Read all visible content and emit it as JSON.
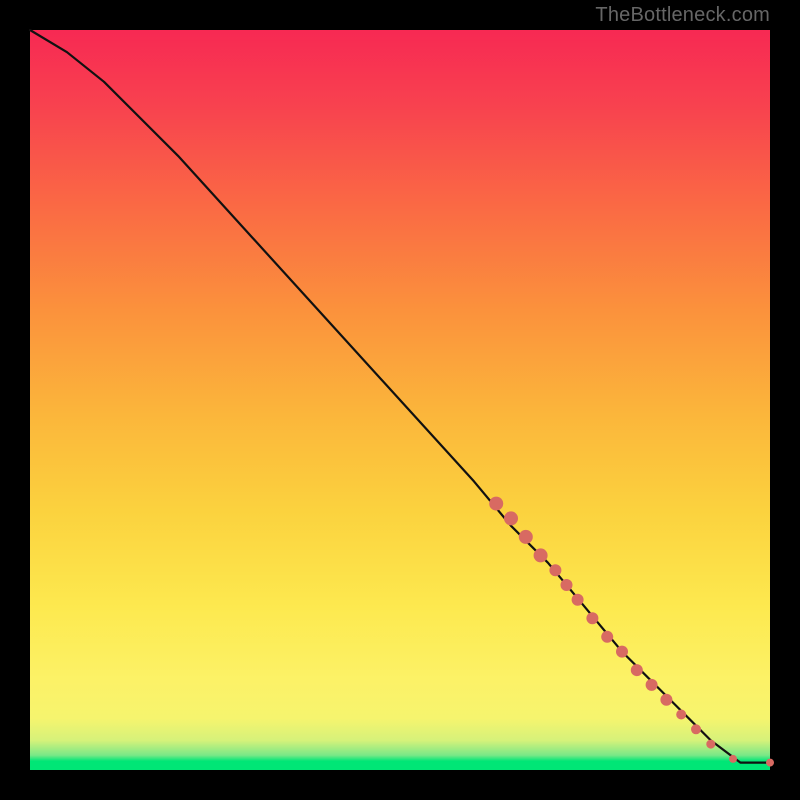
{
  "watermark": "TheBottleneck.com",
  "chart_data": {
    "type": "line",
    "title": "",
    "xlabel": "",
    "ylabel": "",
    "xlim": [
      0,
      100
    ],
    "ylim": [
      0,
      100
    ],
    "grid": false,
    "series": [
      {
        "name": "curve",
        "x": [
          0,
          5,
          10,
          20,
          30,
          40,
          50,
          60,
          65,
          70,
          75,
          80,
          83,
          86,
          89,
          92,
          94,
          96,
          98,
          100
        ],
        "y": [
          100,
          97,
          93,
          83,
          72,
          61,
          50,
          39,
          33,
          28,
          22,
          16,
          13,
          10,
          7,
          4,
          2.5,
          1,
          1,
          1
        ]
      }
    ],
    "scatter": {
      "name": "highlighted-points",
      "color": "#d86a62",
      "points": [
        {
          "x": 63,
          "y": 36,
          "r": 7
        },
        {
          "x": 65,
          "y": 34,
          "r": 7
        },
        {
          "x": 67,
          "y": 31.5,
          "r": 7
        },
        {
          "x": 69,
          "y": 29,
          "r": 7
        },
        {
          "x": 71,
          "y": 27,
          "r": 6
        },
        {
          "x": 72.5,
          "y": 25,
          "r": 6
        },
        {
          "x": 74,
          "y": 23,
          "r": 6
        },
        {
          "x": 76,
          "y": 20.5,
          "r": 6
        },
        {
          "x": 78,
          "y": 18,
          "r": 6
        },
        {
          "x": 80,
          "y": 16,
          "r": 6
        },
        {
          "x": 82,
          "y": 13.5,
          "r": 6
        },
        {
          "x": 84,
          "y": 11.5,
          "r": 6
        },
        {
          "x": 86,
          "y": 9.5,
          "r": 6
        },
        {
          "x": 88,
          "y": 7.5,
          "r": 5
        },
        {
          "x": 90,
          "y": 5.5,
          "r": 5
        },
        {
          "x": 92,
          "y": 3.5,
          "r": 4.5
        },
        {
          "x": 95,
          "y": 1.5,
          "r": 4
        },
        {
          "x": 100,
          "y": 1,
          "r": 4
        }
      ]
    }
  }
}
